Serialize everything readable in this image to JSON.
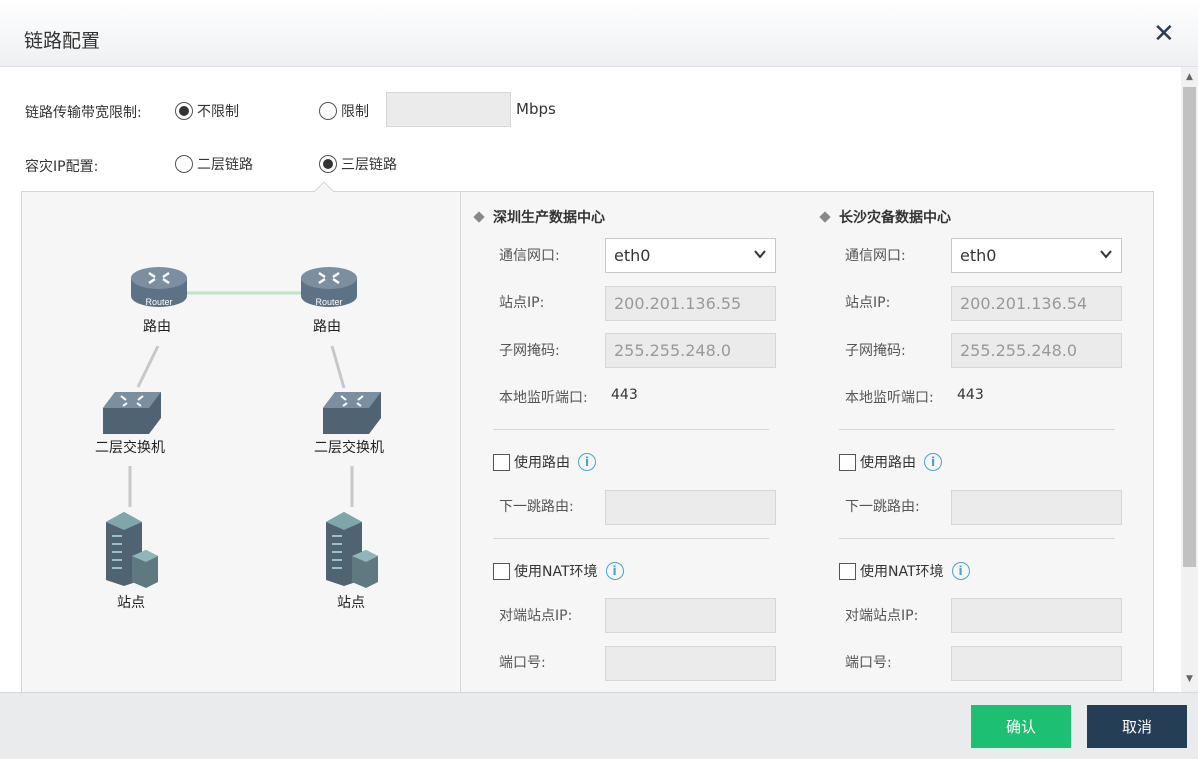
{
  "dialog": {
    "title": "链路配置"
  },
  "bandwidth": {
    "label": "链路传输带宽限制:",
    "option_unlimited": "不限制",
    "option_limited": "限制",
    "selected": "不限制",
    "value": "",
    "unit": "Mbps"
  },
  "dr_ip": {
    "label": "容灾IP配置:",
    "option_l2": "二层链路",
    "option_l3": "三层链路",
    "selected": "三层链路"
  },
  "diagram": {
    "router_text": "Router",
    "left": {
      "router": "路由",
      "switch": "二层交换机",
      "site": "站点"
    },
    "right": {
      "router": "路由",
      "switch": "二层交换机",
      "site": "站点"
    }
  },
  "labels": {
    "interface": "通信网口:",
    "site_ip": "站点IP:",
    "subnet": "子网掩码:",
    "listen_port": "本地监听端口:",
    "use_route": "使用路由",
    "next_hop": "下一跳路由:",
    "use_nat": "使用NAT环境",
    "peer_ip": "对端站点IP:",
    "port_no": "端口号:"
  },
  "primary": {
    "title": "深圳生产数据中心",
    "interface": "eth0",
    "site_ip": "200.201.136.55",
    "subnet": "255.255.248.0",
    "listen_port": "443"
  },
  "backup": {
    "title": "长沙灾备数据中心",
    "interface": "eth0",
    "site_ip": "200.201.136.54",
    "subnet": "255.255.248.0",
    "listen_port": "443"
  },
  "footer": {
    "ok": "确认",
    "cancel": "取消"
  },
  "colors": {
    "ok": "#1dbf73",
    "cancel": "#253e55",
    "info": "#4aa3c7",
    "link": "#bfe3c9"
  }
}
